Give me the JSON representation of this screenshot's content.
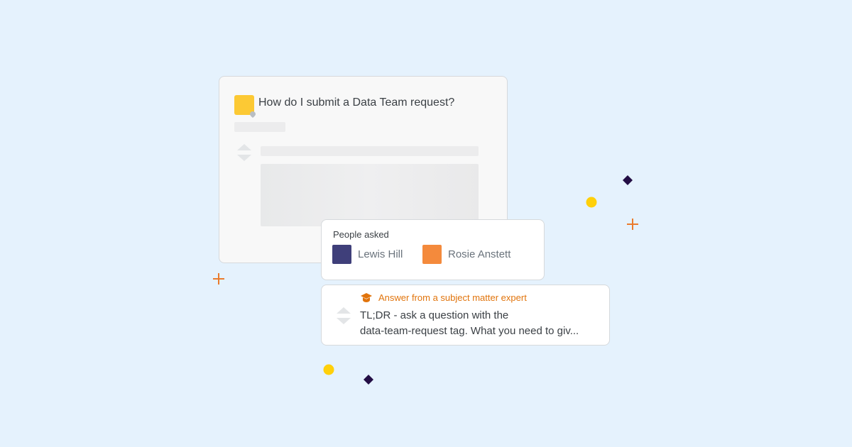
{
  "question": {
    "title": "How do I submit a Data Team request?"
  },
  "people_asked": {
    "label": "People asked",
    "people": [
      {
        "name": "Lewis Hill",
        "avatar_color": "#3f3f7a"
      },
      {
        "name": "Rosie Anstett",
        "avatar_color": "#f48a3c"
      }
    ]
  },
  "answer": {
    "badge_icon": "graduation-cap-icon",
    "badge_label": "Answer from a subject matter expert",
    "line1": "TL;DR - ask a question with the",
    "line2": "data-team-request tag. What you need to giv..."
  },
  "colors": {
    "background": "#e5f2fd",
    "accent_orange": "#e1740c",
    "accent_yellow": "#fcc934",
    "accent_navy": "#230e45"
  }
}
